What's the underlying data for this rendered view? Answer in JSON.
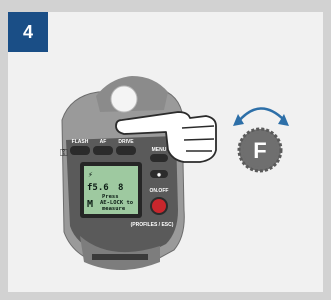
{
  "step": {
    "number": "4"
  },
  "camera": {
    "buttons": {
      "flash": "FLASH",
      "af": "AF",
      "drive": "DRIVE",
      "menu": "MENU",
      "on_off": "ON.OFF",
      "profiles_esc": "(PROFILES / ESC)"
    },
    "lcd": {
      "flash_symbol": "⚡",
      "aperture": "f5.6",
      "value": "8",
      "mode": "M",
      "message_line1": "Press",
      "message_line2": "AE-LOCK to",
      "message_line3": "measure"
    }
  },
  "dial": {
    "letter": "F"
  },
  "colors": {
    "badge": "#1a4e86",
    "panel": "#f1f1f1",
    "frame": "#d2d2d2",
    "lcd": "#9ec9a0",
    "dial": "#6f6f6f",
    "arrow": "#2d6fa8",
    "red_button": "#c8262c"
  }
}
